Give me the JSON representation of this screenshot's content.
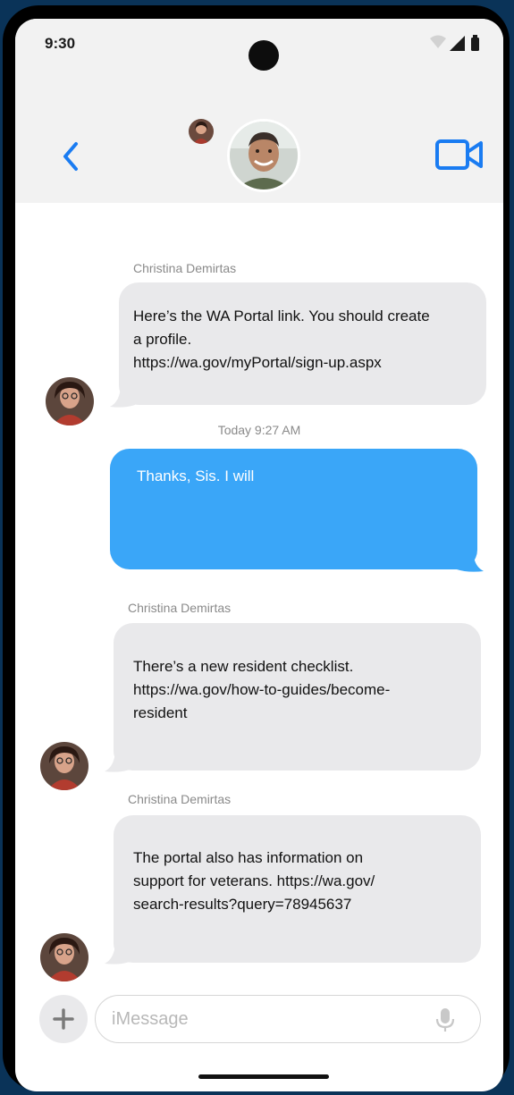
{
  "status_bar": {
    "time": "9:30"
  },
  "header": {
    "back_icon": "chevron-left-icon",
    "video_icon": "video-camera-icon",
    "accent_color": "#1a7cf2"
  },
  "messages": [
    {
      "sender": "Christina Demirtas",
      "direction": "received",
      "lines": [
        "Here’s the WA Portal link. You should create",
        "a profile.",
        "https://wa.gov/myPortal/sign-up.aspx"
      ]
    },
    {
      "timestamp": "Today 9:27 AM",
      "direction": "sent",
      "lines": [
        "Thanks, Sis. I will"
      ]
    },
    {
      "sender": "Christina Demirtas",
      "direction": "received",
      "lines": [
        "There’s a new resident checklist.",
        "https://wa.gov/how-to-guides/become-",
        "resident"
      ]
    },
    {
      "sender": "Christina Demirtas",
      "direction": "received",
      "lines": [
        "The portal also has information on",
        "support for veterans. https://wa.gov/",
        "search-results?query=78945637"
      ]
    }
  ],
  "composer": {
    "placeholder": "iMessage",
    "plus_icon": "plus-icon",
    "mic_icon": "microphone-icon"
  },
  "colors": {
    "received_bubble": "#e9e9eb",
    "sent_bubble": "#3aa6f8",
    "header_bg": "#f2f2f2"
  }
}
